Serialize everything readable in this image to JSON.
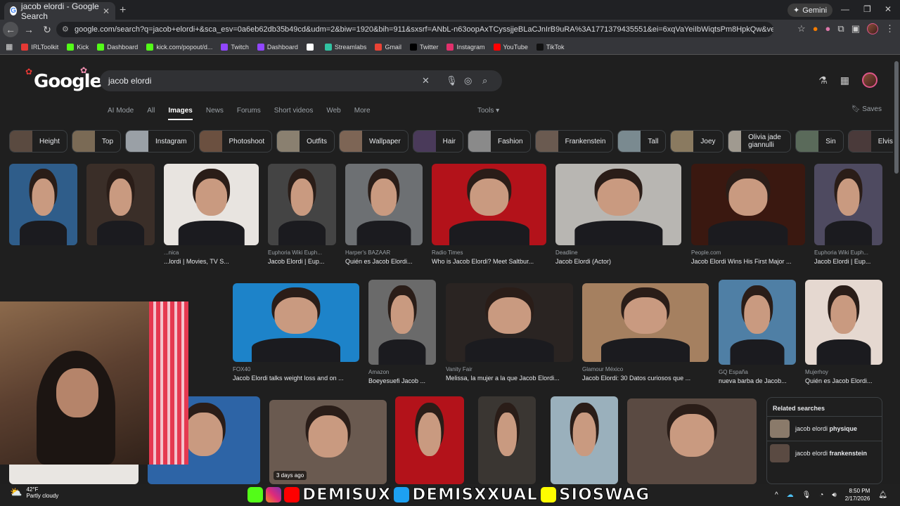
{
  "browser": {
    "tab_title": "jacob elordi - Google Search",
    "tab_close": "✕",
    "new_tab": "+",
    "gemini_label": "Gemini",
    "url": "google.com/search?q=jacob+elordi+&sca_esv=0a6eb62db35b49cd&udm=2&biw=1920&bih=911&sxsrf=ANbL-n63oopAxTCyssjjeBLaCJnIrB9uRA%3A1771379435551&ei=6xqVaYeiIbWiqtsPm8HpkQw&ved=0ahUKEwjHw5LQ9uGSAxUK...",
    "bookmarks": [
      {
        "label": "IRLToolkit",
        "color": "#e53935"
      },
      {
        "label": "Kick",
        "color": "#53fc18"
      },
      {
        "label": "Dashboard",
        "color": "#53fc18"
      },
      {
        "label": "kick.com/popout/d...",
        "color": "#53fc18"
      },
      {
        "label": "Twitch",
        "color": "#9146ff"
      },
      {
        "label": "Dashboard",
        "color": "#9146ff"
      },
      {
        "label": "",
        "color": "#ffffff"
      },
      {
        "label": "Streamlabs",
        "color": "#31c3a2"
      },
      {
        "label": "Gmail",
        "color": "#ea4335"
      },
      {
        "label": "Twitter",
        "color": "#000000"
      },
      {
        "label": "Instagram",
        "color": "#e1306c"
      },
      {
        "label": "YouTube",
        "color": "#ff0000"
      },
      {
        "label": "TikTok",
        "color": "#111111"
      }
    ]
  },
  "google": {
    "logo": "Google",
    "query": "jacob elordi",
    "nav_tabs": [
      "AI Mode",
      "All",
      "Images",
      "News",
      "Forums",
      "Short videos",
      "Web",
      "More"
    ],
    "active_tab": "Images",
    "tools": "Tools",
    "saves": "Saves",
    "chips": [
      {
        "label": "Height",
        "color": "#5a4a40"
      },
      {
        "label": "Top",
        "color": "#7a6a55"
      },
      {
        "label": "Instagram",
        "color": "#9aa0a6"
      },
      {
        "label": "Photoshoot",
        "color": "#6b5040"
      },
      {
        "label": "Outfits",
        "color": "#8a8070"
      },
      {
        "label": "Wallpaper",
        "color": "#7d6555"
      },
      {
        "label": "Hair",
        "color": "#4a3a5a"
      },
      {
        "label": "Fashion",
        "color": "#8a8a8a"
      },
      {
        "label": "Frankenstein",
        "color": "#6a5a50"
      },
      {
        "label": "Tall",
        "color": "#7a8a90"
      },
      {
        "label": "Joey",
        "color": "#8a7a60"
      },
      {
        "label": "Olivia jade giannulli",
        "color": "#a09a90"
      },
      {
        "label": "Sin",
        "color": "#5a6a5a"
      },
      {
        "label": "Elvis",
        "color": "#4a3a3a"
      }
    ],
    "results_row1": [
      {
        "source": "",
        "caption": "",
        "color": "#2f5d8a"
      },
      {
        "source": "",
        "caption": "",
        "color": "#3a2e28"
      },
      {
        "source": "...nica",
        "caption": "...lordi | Movies, TV S...",
        "color": "#e8e4e0"
      },
      {
        "source": "Euphoria Wiki Euph...",
        "caption": "Jacob Elordi | Eup...",
        "color": "#444"
      },
      {
        "source": "Harper's BAZAAR",
        "caption": "Quién es Jacob Elordi...",
        "color": "#6d7073"
      },
      {
        "source": "Radio Times",
        "caption": "Who is Jacob Elordi? Meet Saltbur...",
        "color": "#b3121a"
      },
      {
        "source": "Deadline",
        "caption": "Jacob Elordi (Actor)",
        "color": "#b8b6b2"
      },
      {
        "source": "People.com",
        "caption": "Jacob Elordi Wins His First Major ...",
        "color": "#3a1810"
      },
      {
        "source": "Euphoria Wiki Euph...",
        "caption": "Jacob Elordi | Eup...",
        "color": "#4e4a60"
      }
    ],
    "results_row2": [
      {
        "source": "FOX40",
        "caption": "Jacob Elordi talks weight loss and on ...",
        "color": "#1d83c9"
      },
      {
        "source": "Amazon",
        "caption": "Boeyesuefi Jacob ...",
        "color": "#6a6a6a"
      },
      {
        "source": "Vanity Fair",
        "caption": "Melissa, la mujer a la que Jacob Elordi...",
        "color": "#2a2422"
      },
      {
        "source": "Glamour México",
        "caption": "Jacob Elordi: 30 Datos curiosos que ...",
        "color": "#a58060"
      },
      {
        "source": "GQ España",
        "caption": "nueva barba de Jacob...",
        "color": "#4f7fa5"
      },
      {
        "source": "Mujerhoy",
        "caption": "Quién es Jacob Elordi...",
        "color": "#e5d8d0"
      }
    ],
    "row3_badge": "3 days ago",
    "related_title": "Related searches",
    "related": [
      {
        "prefix": "jacob elordi ",
        "bold": "physique"
      },
      {
        "prefix": "jacob elordi ",
        "bold": "frankenstein"
      }
    ]
  },
  "overlay": {
    "banner_text": [
      "DEMISUX",
      "DEMISXXUAL",
      "SIOSWAG"
    ]
  },
  "taskbar": {
    "temp": "42°F",
    "weather": "Partly cloudy",
    "time": "8:50 PM",
    "date": "2/17/2026"
  }
}
